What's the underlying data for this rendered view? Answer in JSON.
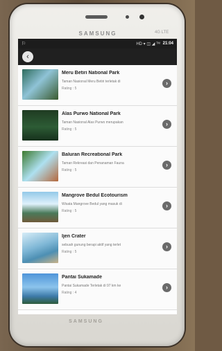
{
  "device": {
    "brand": "SAMSUNG",
    "brand_right": "4G LTE",
    "home_label": "SAMSUNG"
  },
  "statusbar": {
    "left_icon": "notification-icon",
    "indicators": "HD ▾ ◫ ◢ ᵀᴹ",
    "time": "21:04"
  },
  "appbar": {
    "back_glyph": "‹"
  },
  "list": {
    "items": [
      {
        "title": "Meru Betiri National Park",
        "desc": "Taman Nasional Meru Betiri terletak di",
        "rating": "Rating : 5"
      },
      {
        "title": "Alas Purwo National Park",
        "desc": "Taman Nasional Alas Purwo merupakan",
        "rating": "Rating : 5"
      },
      {
        "title": "Baluran Recreational Park",
        "desc": "Taman Rekreasi dan Penanaman Fauna",
        "rating": "Rating : 5"
      },
      {
        "title": "Mangrove Bedul Ecotourism",
        "desc": "Wisata Mangrove Bedul yang masuk di",
        "rating": "Rating : 5"
      },
      {
        "title": "Ijen Crater",
        "desc": "sebuah gunung berapi aktif yang terlet",
        "rating": "Rating : 5"
      },
      {
        "title": "Pantai Sukamade",
        "desc": "Pantai Sukamade Terletak di 97 km ke",
        "rating": "Rating : 4"
      }
    ],
    "chevron": "›"
  }
}
